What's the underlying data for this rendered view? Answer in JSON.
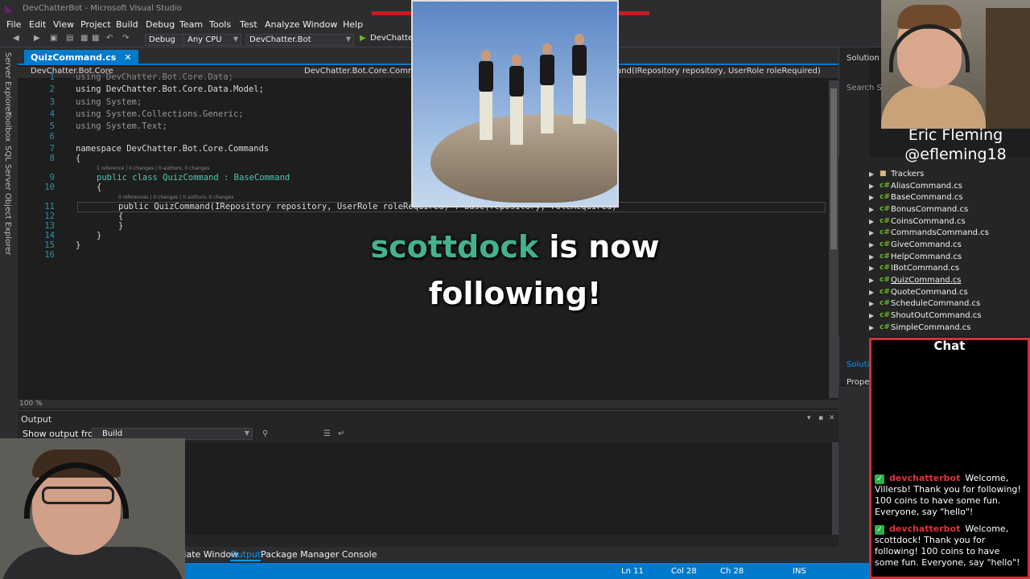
{
  "window": {
    "title": "DevChatterBot - Microsoft Visual Studio"
  },
  "menu": [
    "File",
    "Edit",
    "View",
    "Project",
    "Build",
    "Debug",
    "Team",
    "Tools",
    "Test",
    "Analyze",
    "Window",
    "Help"
  ],
  "toolbar": {
    "config": "Debug",
    "platform": "Any CPU",
    "startup_project": "DevChatter.Bot",
    "run_target": "DevChatter.B"
  },
  "left_rail": [
    "Server Explorer",
    "Toolbox",
    "SQL Server Object Explorer"
  ],
  "editor": {
    "active_tab": "QuizCommand.cs",
    "nav_project": "DevChatter.Bot.Core",
    "nav_class": "DevChatter.Bot.Core.Comman",
    "nav_member": "and(IRepository repository, UserRole roleRequired)",
    "codelens_class": "1 reference | 0 changes | 0 authors, 0 changes",
    "codelens_ctor": "0 references | 0 changes | 0 authors, 0 changes",
    "zoom": "100 %",
    "lines": [
      {
        "num": "1",
        "text": "using DevChatter.Bot.Core.Data;"
      },
      {
        "num": "2",
        "text": "using DevChatter.Bot.Core.Data.Model;"
      },
      {
        "num": "3",
        "text": "using System;"
      },
      {
        "num": "4",
        "text": "using System.Collections.Generic;"
      },
      {
        "num": "5",
        "text": "using System.Text;"
      },
      {
        "num": "6",
        "text": ""
      },
      {
        "num": "7",
        "text": "namespace DevChatter.Bot.Core.Commands"
      },
      {
        "num": "8",
        "text": "{"
      },
      {
        "num": "9",
        "text": "public class QuizCommand : BaseCommand"
      },
      {
        "num": "10",
        "text": "{"
      },
      {
        "num": "11",
        "text": "public QuizCommand(IRepository repository, UserRole roleRequired) : base(repository, roleRequired)"
      },
      {
        "num": "12",
        "text": "{"
      },
      {
        "num": "13",
        "text": "}"
      },
      {
        "num": "14",
        "text": "}"
      },
      {
        "num": "15",
        "text": "}"
      },
      {
        "num": "16",
        "text": ""
      }
    ]
  },
  "output": {
    "title": "Output",
    "source_label": "Show output from:",
    "source_value": "Build"
  },
  "bottom_tabs": [
    "Immediate Window",
    "Output",
    "Package Manager Console"
  ],
  "status": {
    "line": "Ln 11",
    "col": "Col 28",
    "ch": "Ch 28",
    "mode": "INS"
  },
  "solution": {
    "header": "Solution",
    "search": "Search S",
    "footer": "Solutio",
    "properties": "Proper",
    "folder": "Trackers",
    "files": [
      "AliasCommand.cs",
      "BaseCommand.cs",
      "BonusCommand.cs",
      "CoinsCommand.cs",
      "CommandsCommand.cs",
      "GiveCommand.cs",
      "HelpCommand.cs",
      "IBotCommand.cs",
      "QuizCommand.cs",
      "QuoteCommand.cs",
      "ScheduleCommand.cs",
      "ShoutOutCommand.cs",
      "SimpleCommand.cs"
    ]
  },
  "overlay": {
    "host_name": "Eric Fleming",
    "host_handle": "@efleming18",
    "alert_user": "scottdock",
    "alert_text_1": " is now",
    "alert_text_2": "following!",
    "chat_title": "Chat",
    "chat_messages": [
      {
        "user": "devchatterbot",
        "text": "Welcome, Villersb! Thank you for following! 100 coins to have some fun. Everyone, say \"hello\"!"
      },
      {
        "user": "devchatterbot",
        "text": "Welcome, scottdock! Thank you for following! 100 coins to have some fun. Everyone, say \"hello\"!"
      }
    ],
    "alert_user_color": "#44b28b",
    "chat_border_color": "#d0303a"
  },
  "colors": {
    "accent": "#007acc",
    "keyword": "#569cd6",
    "type": "#4ec9b0"
  }
}
